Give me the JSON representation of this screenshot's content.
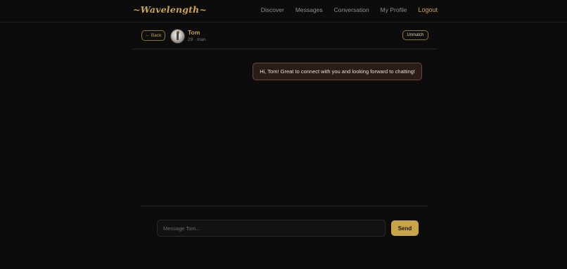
{
  "app": {
    "logo": "~Wavelength~",
    "nav": [
      "Discover",
      "Messages",
      "Conversation",
      "My Profile",
      "Logout"
    ]
  },
  "conversation": {
    "back_label": "← Back",
    "peer_name": "Tom",
    "peer_meta": "29 · man",
    "unmatch_label": "Unmatch",
    "messages": [
      {
        "from": "me",
        "text": "Hi, Tom! Great to connect with you and looking forward to chatting!"
      }
    ]
  },
  "composer": {
    "placeholder": "Message Tom...",
    "value": "",
    "send_label": "Send"
  },
  "colors": {
    "background": "#0c0c0c",
    "accent": "#c9a54a",
    "bubble_bg": "#2a1c16",
    "bubble_border": "#6b4a3a"
  }
}
